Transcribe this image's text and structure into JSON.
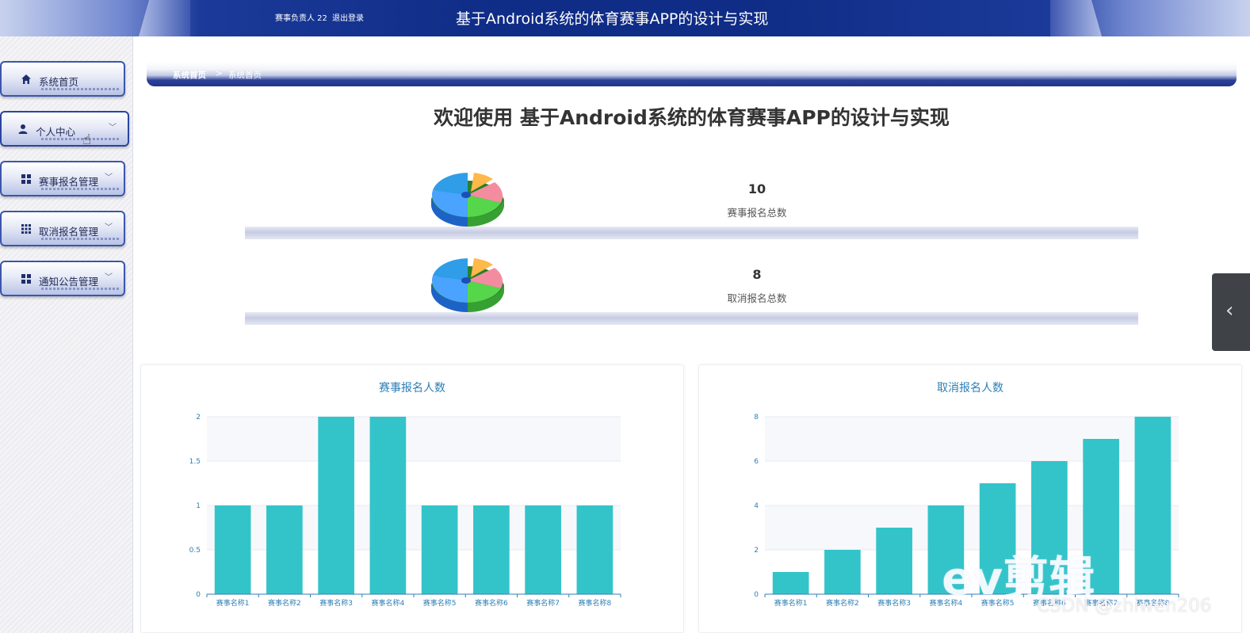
{
  "header": {
    "user_label": "赛事负责人 22",
    "logout_label": "退出登录",
    "app_title": "基于Android系统的体育赛事APP的设计与实现"
  },
  "sidebar": {
    "items": [
      {
        "label": "系统首页",
        "icon": "home-icon",
        "has_submenu": false,
        "active": false
      },
      {
        "label": "个人中心",
        "icon": "user-icon",
        "has_submenu": true,
        "active": true
      },
      {
        "label": "赛事报名管理",
        "icon": "grid-icon",
        "has_submenu": true,
        "active": false
      },
      {
        "label": "取消报名管理",
        "icon": "grid-nine-icon",
        "has_submenu": true,
        "active": false
      },
      {
        "label": "通知公告管理",
        "icon": "grid-icon",
        "has_submenu": true,
        "active": false
      }
    ]
  },
  "breadcrumb": {
    "home": "系统首页",
    "separator": ">",
    "current": "系统首页"
  },
  "welcome": "欢迎使用 基于Android系统的体育赛事APP的设计与实现",
  "stats": [
    {
      "value": "10",
      "caption": "赛事报名总数",
      "icon": "pie-chart-icon"
    },
    {
      "value": "8",
      "caption": "取消报名总数",
      "icon": "pie-chart-icon"
    }
  ],
  "colors": {
    "bar": "#33c4c9",
    "header": "#0f2c86",
    "chart_title": "#2e7fb5"
  },
  "chart_data": [
    {
      "type": "bar",
      "title": "赛事报名人数",
      "categories": [
        "赛事名称1",
        "赛事名称2",
        "赛事名称3",
        "赛事名称4",
        "赛事名称5",
        "赛事名称6",
        "赛事名称7",
        "赛事名称8"
      ],
      "values": [
        1,
        1,
        2,
        2,
        1,
        1,
        1,
        1
      ],
      "ylim": [
        0,
        2
      ],
      "yticks": [
        "0",
        "0.5",
        "1",
        "1.5",
        "2"
      ],
      "ytick_values": [
        0,
        0.5,
        1,
        1.5,
        2
      ],
      "grid": true
    },
    {
      "type": "bar",
      "title": "取消报名人数",
      "categories": [
        "赛事名称1",
        "赛事名称2",
        "赛事名称3",
        "赛事名称4",
        "赛事名称5",
        "赛事名称6",
        "赛事名称7",
        "赛事名称8"
      ],
      "values": [
        1,
        2,
        3,
        4,
        5,
        6,
        7,
        8
      ],
      "ylim": [
        0,
        8
      ],
      "yticks": [
        "0",
        "2",
        "4",
        "6",
        "8"
      ],
      "ytick_values": [
        0,
        2,
        4,
        6,
        8
      ],
      "grid": true
    }
  ],
  "side_handle": {
    "icon": "chevron-left-icon"
  },
  "watermarks": {
    "ev": "ev剪辑",
    "csdn": "CSDN @zhiwen206"
  }
}
